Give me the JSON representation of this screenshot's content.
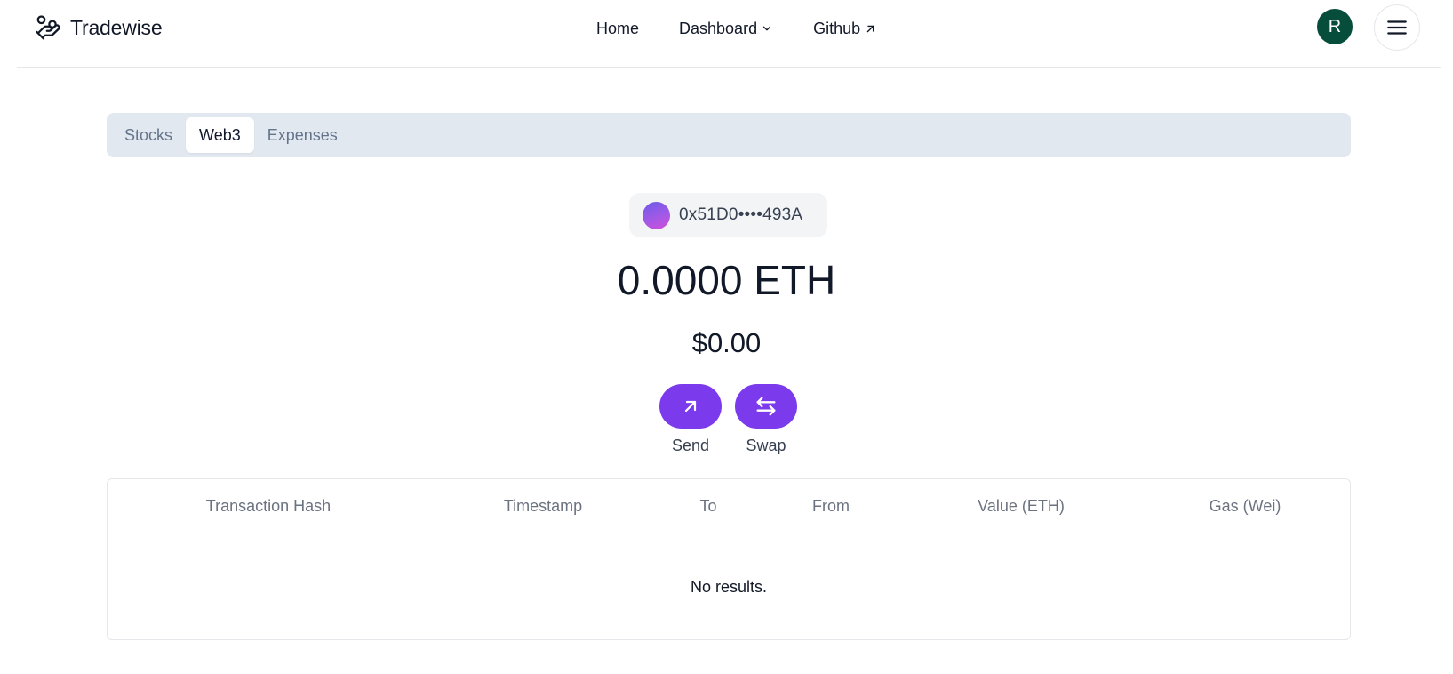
{
  "header": {
    "brand": "Tradewise",
    "nav": {
      "home": "Home",
      "dashboard": "Dashboard",
      "github": "Github"
    },
    "avatar_initial": "R"
  },
  "tabs": [
    {
      "label": "Stocks",
      "active": false
    },
    {
      "label": "Web3",
      "active": true
    },
    {
      "label": "Expenses",
      "active": false
    }
  ],
  "wallet": {
    "address": "0x51D0••••493A",
    "balance_eth": "0.0000 ETH",
    "balance_usd": "$0.00"
  },
  "actions": {
    "send": "Send",
    "swap": "Swap"
  },
  "table": {
    "columns": [
      "Transaction Hash",
      "Timestamp",
      "To",
      "From",
      "Value (ETH)",
      "Gas (Wei)"
    ],
    "empty_message": "No results."
  },
  "colors": {
    "accent": "#7c3aed",
    "avatar_bg": "#064e3b",
    "tabs_bg": "#e2e8f0"
  },
  "icons": {
    "brand": "hand-coins-icon",
    "dashboard": "chevron-down-icon",
    "github": "arrow-up-right-icon",
    "menu": "menu-icon",
    "send": "arrow-up-right-icon",
    "swap": "swap-arrows-icon"
  }
}
